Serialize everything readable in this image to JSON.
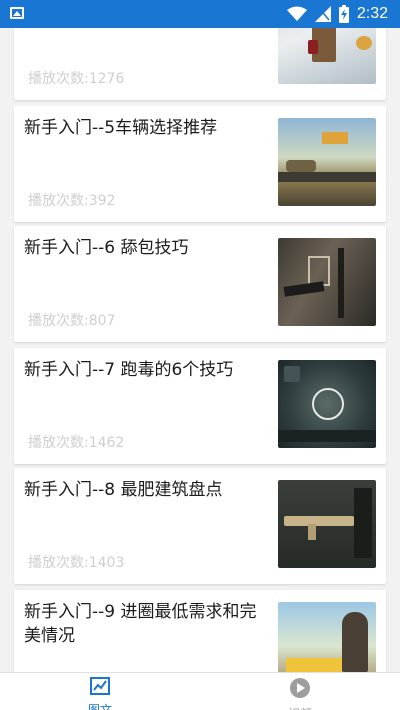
{
  "status_bar": {
    "time": "2:32",
    "icons": [
      "image-icon",
      "wifi-icon",
      "signal-icon",
      "battery-charging-icon"
    ]
  },
  "articles": [
    {
      "title": "",
      "plays_label": "播放次数:1276"
    },
    {
      "title": "新手入门--5车辆选择推荐",
      "plays_label": "播放次数:392"
    },
    {
      "title": "新手入门--6  舔包技巧",
      "plays_label": "播放次数:807"
    },
    {
      "title": "新手入门--7  跑毒的6个技巧",
      "plays_label": "播放次数:1462"
    },
    {
      "title": "新手入门--8  最肥建筑盘点",
      "plays_label": "播放次数:1403"
    },
    {
      "title": "新手入门--9  进圈最低需求和完美情况",
      "plays_label": ""
    }
  ],
  "tabbar": {
    "tabs": [
      {
        "label": "图文",
        "icon": "chart-icon",
        "active": true
      },
      {
        "label": "视频",
        "icon": "play-icon",
        "active": false
      }
    ],
    "colors": {
      "active": "#1976d2",
      "inactive": "#9e9e9e"
    }
  }
}
